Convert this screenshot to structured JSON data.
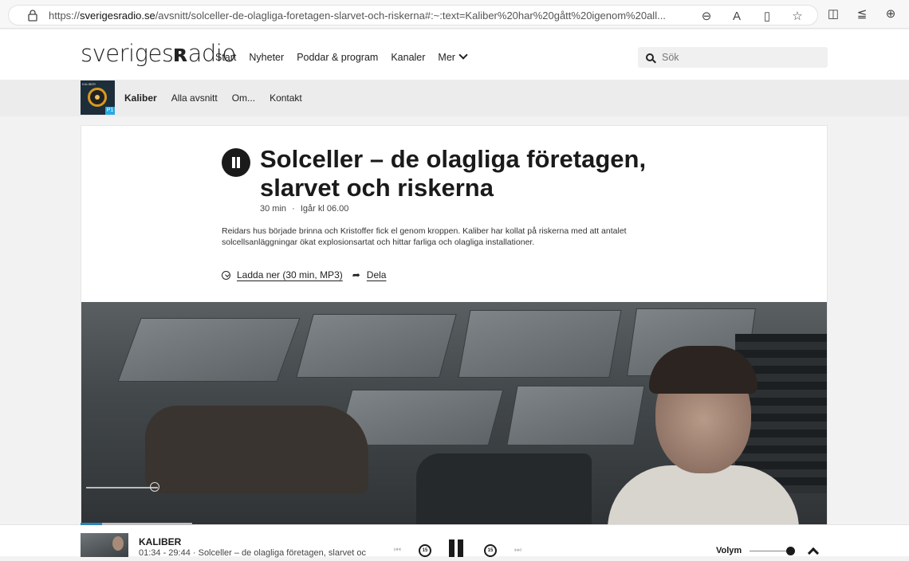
{
  "browser": {
    "url_scheme": "https://",
    "url_host": "sverigesradio.se",
    "url_rest": "/avsnitt/solceller-de-olagliga-foretagen-slarvet-och-riskerna#:~:text=Kaliber%20har%20gått%20igenom%20all...",
    "icons": [
      "zoom-out-icon",
      "read-aloud-icon",
      "immersive-reader-icon",
      "favorite-star-icon",
      "split-screen-icon",
      "favorites-list-icon",
      "collections-icon"
    ]
  },
  "site": {
    "logo_part1": "sveriges",
    "logo_mark": "ʀ",
    "logo_part2": "adio",
    "nav": [
      "Start",
      "Nyheter",
      "Poddar & program",
      "Kanaler",
      "Mer"
    ],
    "search_placeholder": "Sök"
  },
  "program": {
    "name": "Kaliber",
    "nav": [
      "Alla avsnitt",
      "Om...",
      "Kontakt"
    ],
    "thumb_label": "KALIBER",
    "thumb_channel": "P1"
  },
  "episode": {
    "title": "Solceller – de olagliga företagen, slarvet och riskerna",
    "duration": "30 min",
    "separator": "·",
    "published": "Igår kl 06.00",
    "description": "Reidars hus började brinna och Kristoffer fick el genom kroppen. Kaliber har kollat på riskerna med att antalet solcellsanläggningar ökat explosionsartat och hittar farliga och olagliga installationer.",
    "download_label": "Ladda ner (30 min, MP3)",
    "share_label": "Dela"
  },
  "player": {
    "program": "KALIBER",
    "info": "01:34 - 29:44 · Solceller – de olagliga företagen, slarvet oc",
    "progress": 0.053,
    "jump_back": "15",
    "jump_forward": "15",
    "volume_label": "Volym",
    "volume": 0.9
  }
}
